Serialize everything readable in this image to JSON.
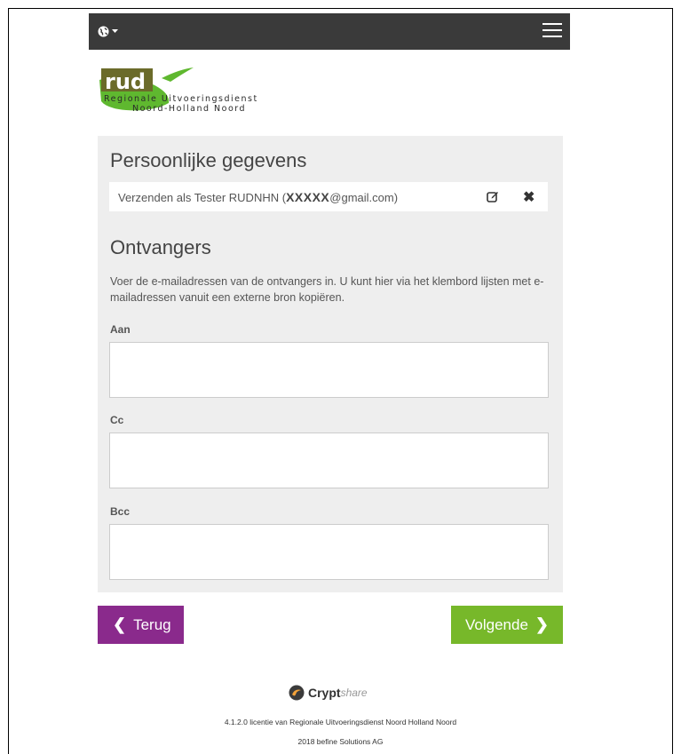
{
  "navbar": {
    "language_icon": "globe-icon",
    "menu_icon": "hamburger-icon"
  },
  "logo": {
    "brand": "rud",
    "line1": "Regionale Uitvoeringsdienst",
    "line2": "Noord-Holland Noord"
  },
  "personal": {
    "title": "Persoonlijke gegevens",
    "sender_prefix": "Verzenden als Tester RUDNHN (",
    "sender_masked": "XXXXX",
    "sender_suffix": "@gmail.com)"
  },
  "recipients": {
    "title": "Ontvangers",
    "description": "Voer de e-mailadressen van de ontvangers in. U kunt hier via het klembord lijsten met e-mailadressen vanuit een externe bron kopiëren.",
    "to_label": "Aan",
    "to_value": "",
    "cc_label": "Cc",
    "cc_value": "",
    "bcc_label": "Bcc",
    "bcc_value": ""
  },
  "actions": {
    "back_label": "Terug",
    "next_label": "Volgende"
  },
  "footer": {
    "brand_bold": "Crypt",
    "brand_italic": "share",
    "license": "4.1.2.0 licentie van Regionale Uitvoeringsdienst Noord Holland Noord",
    "copyright": "2018 befine Solutions AG"
  },
  "colors": {
    "back": "#8a2a8c",
    "next": "#77b82a",
    "navbar": "#3a3a3a",
    "logo_green": "#5fb82f",
    "logo_olive": "#6b6b2a"
  }
}
